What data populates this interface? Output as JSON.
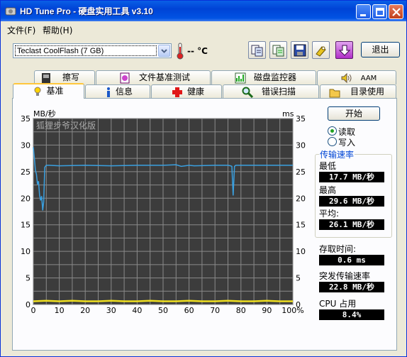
{
  "window": {
    "title": "HD Tune Pro - 硬盘实用工具 v3.10"
  },
  "menu": {
    "items": [
      "文件(F)",
      "帮助(H)"
    ]
  },
  "toolbar": {
    "drive": "Teclast CoolFlash (7 GB)",
    "temperature": "-- °C",
    "exit_label": "退出",
    "tool_icons": [
      "copy-info-icon",
      "copy-screen-icon",
      "save-icon",
      "options-icon",
      "download-icon"
    ]
  },
  "tabs": {
    "top": [
      "擦写",
      "文件基准测试",
      "磁盘监控器",
      "AAM"
    ],
    "bottom": [
      "基准",
      "信息",
      "健康",
      "错误扫描",
      "目录使用"
    ],
    "active": "基准"
  },
  "controls": {
    "start_label": "开始",
    "read_label": "读取",
    "write_label": "写入",
    "read_selected": true
  },
  "stats": {
    "group_title": "传输速率",
    "min_label": "最低",
    "min_value": "17.7 MB/秒",
    "max_label": "最高",
    "max_value": "29.6 MB/秒",
    "avg_label": "平均:",
    "avg_value": "26.1 MB/秒",
    "access_label": "存取时间:",
    "access_value": "0.6 ms",
    "burst_label": "突发传输速率",
    "burst_value": "22.8 MB/秒",
    "cpu_label": "CPU 占用",
    "cpu_value": "8.4%"
  },
  "chart_data": {
    "type": "line",
    "watermark": "狐狸步爷汉化版",
    "ylabel_left": "MB/秒",
    "ylabel_right": "ms",
    "y_ticks": [
      0,
      5,
      10,
      15,
      20,
      25,
      30,
      35
    ],
    "x_ticks": [
      "0",
      "10",
      "20",
      "30",
      "40",
      "50",
      "60",
      "70",
      "80",
      "90",
      "100%"
    ],
    "xlim": [
      0,
      100
    ],
    "ylim": [
      0,
      35
    ],
    "grid": true,
    "series": [
      {
        "color": "#3aa0e0",
        "x": [
          0,
          0.4,
          0.8,
          1.2,
          1.6,
          2,
          2.4,
          2.8,
          3.2,
          3.6,
          4,
          4.4,
          4.8,
          5,
          6,
          10,
          20,
          30,
          40,
          50,
          55,
          57,
          60,
          62,
          70,
          75,
          76,
          76.5,
          77,
          77.5,
          78,
          80,
          90,
          100
        ],
        "y": [
          29.6,
          27.5,
          25.3,
          24.5,
          22.6,
          23.2,
          20.6,
          19.6,
          20.4,
          17.7,
          19.3,
          25.8,
          26.1,
          26.2,
          26.2,
          26.1,
          26.2,
          26.1,
          26.2,
          26.2,
          26.3,
          26.0,
          26.2,
          26.1,
          26.2,
          26.2,
          26.1,
          26.0,
          20.5,
          26.0,
          26.2,
          26.2,
          26.2,
          26.2
        ]
      },
      {
        "color": "#f0e020",
        "x": [
          0,
          5,
          10,
          15,
          20,
          25,
          30,
          35,
          40,
          45,
          50,
          55,
          60,
          65,
          70,
          75,
          80,
          85,
          90,
          95,
          100
        ],
        "y": [
          0.6,
          0.7,
          0.6,
          0.7,
          0.6,
          0.6,
          0.7,
          0.6,
          0.6,
          0.7,
          0.6,
          0.6,
          0.7,
          0.6,
          0.6,
          0.7,
          0.6,
          0.6,
          0.7,
          0.6,
          0.6
        ]
      }
    ]
  }
}
